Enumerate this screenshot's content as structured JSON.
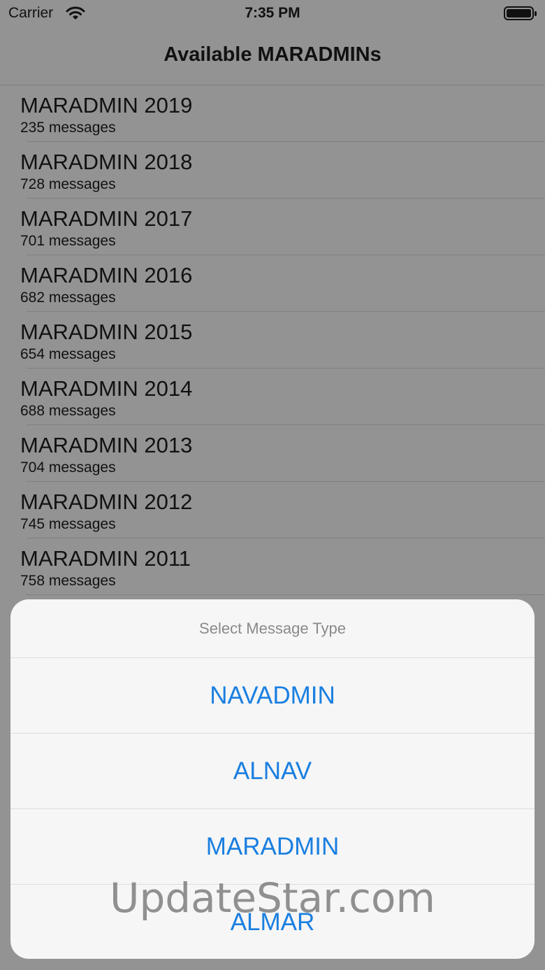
{
  "status_bar": {
    "carrier": "Carrier",
    "time": "7:35 PM"
  },
  "nav": {
    "title": "Available MARADMINs"
  },
  "list": {
    "items": [
      {
        "title": "MARADMIN 2019",
        "subtitle": "235 messages"
      },
      {
        "title": "MARADMIN 2018",
        "subtitle": "728 messages"
      },
      {
        "title": "MARADMIN 2017",
        "subtitle": "701 messages"
      },
      {
        "title": "MARADMIN 2016",
        "subtitle": "682 messages"
      },
      {
        "title": "MARADMIN 2015",
        "subtitle": "654 messages"
      },
      {
        "title": "MARADMIN 2014",
        "subtitle": "688 messages"
      },
      {
        "title": "MARADMIN 2013",
        "subtitle": "704 messages"
      },
      {
        "title": "MARADMIN 2012",
        "subtitle": "745 messages"
      },
      {
        "title": "MARADMIN 2011",
        "subtitle": "758 messages"
      }
    ]
  },
  "action_sheet": {
    "title": "Select Message Type",
    "actions": [
      "NAVADMIN",
      "ALNAV",
      "MARADMIN",
      "ALMAR"
    ]
  },
  "watermark": "UpdateStar.com",
  "colors": {
    "accent": "#1a7fe0",
    "dim_background": "#939393",
    "sheet_background": "#f6f6f6"
  }
}
